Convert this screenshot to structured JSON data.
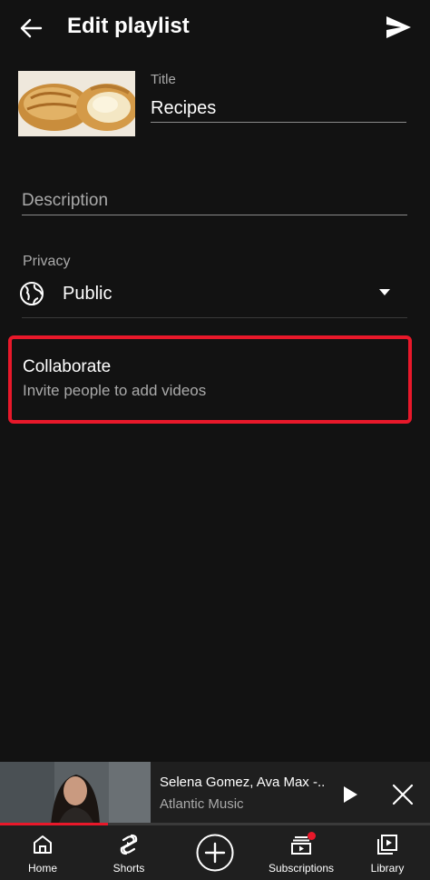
{
  "header": {
    "title": "Edit playlist",
    "back_icon": "arrow-left-icon",
    "send_icon": "send-icon"
  },
  "playlist": {
    "title_label": "Title",
    "title_value": "Recipes",
    "description_placeholder": "Description",
    "thumbnail": "pastry-thumbnail"
  },
  "privacy": {
    "label": "Privacy",
    "value": "Public",
    "icon": "globe-icon"
  },
  "collaborate": {
    "title": "Collaborate",
    "subtitle": "Invite people to add videos",
    "highlight_color": "#e8182a"
  },
  "mini_player": {
    "title": "Selena Gomez, Ava Max -..",
    "channel": "Atlantic Music",
    "progress": 0.25
  },
  "bottom_nav": {
    "items": [
      {
        "label": "Home",
        "icon": "home-icon"
      },
      {
        "label": "Shorts",
        "icon": "shorts-icon"
      },
      {
        "label": "",
        "icon": "create-plus-icon"
      },
      {
        "label": "Subscriptions",
        "icon": "subscriptions-icon"
      },
      {
        "label": "Library",
        "icon": "library-icon"
      }
    ]
  },
  "colors": {
    "background": "#121212",
    "accent": "#e8182a",
    "secondary_text": "#aaaaaa"
  }
}
